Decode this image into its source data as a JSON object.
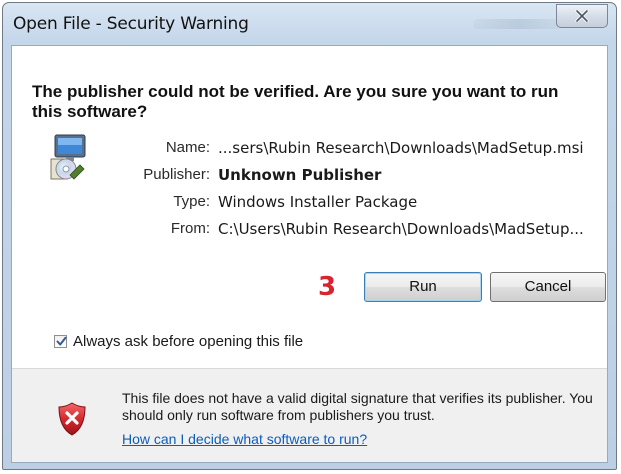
{
  "window": {
    "title": "Open File - Security Warning",
    "close_label": "✕"
  },
  "dialog": {
    "heading": "The publisher could not be verified.  Are you sure you want to run this software?",
    "fields": [
      {
        "label": "Name:",
        "value": "...sers\\Rubin Research\\Downloads\\MadSetup.msi",
        "bold": false
      },
      {
        "label": "Publisher:",
        "value": "Unknown Publisher",
        "bold": true
      },
      {
        "label": "Type:",
        "value": "Windows Installer Package",
        "bold": false
      },
      {
        "label": "From:",
        "value": "C:\\Users\\Rubin Research\\Downloads\\MadSetup...",
        "bold": false
      }
    ],
    "step_number": "3",
    "buttons": {
      "run": "Run",
      "cancel": "Cancel"
    },
    "checkbox": {
      "label": "Always ask before opening this file",
      "checked": true
    }
  },
  "footer": {
    "text": "This file does not have a valid digital signature that verifies its publisher.  You should only run software from publishers you trust.",
    "link": "How can I decide what software to run?"
  },
  "icons": {
    "installer": "windows-installer-icon",
    "warning": "security-shield-warning-icon",
    "close": "close-icon",
    "check": "checkmark-icon"
  },
  "colors": {
    "step_number": "#d9232e",
    "link": "#0a5dbd",
    "shield_red": "#c8202a"
  }
}
